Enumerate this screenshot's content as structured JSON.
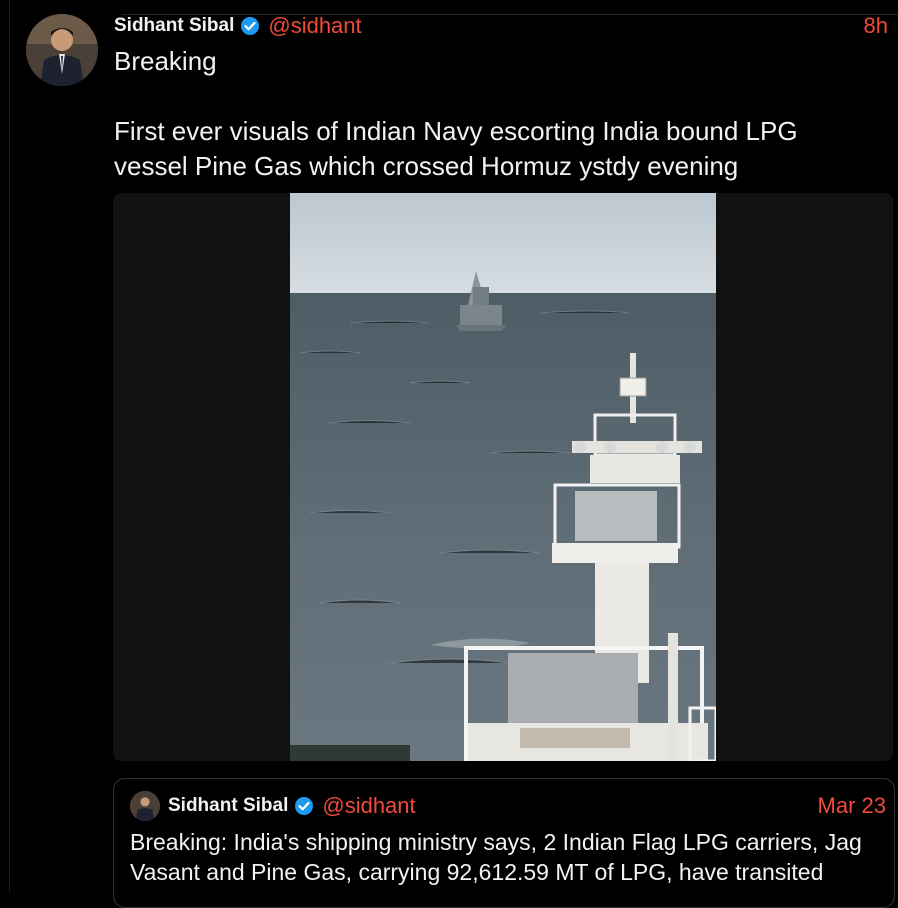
{
  "tweet": {
    "author_name": "Sidhant Sibal",
    "handle": "@sidhant",
    "time": "8h",
    "text": "Breaking\n\nFirst ever visuals of Indian Navy escorting India bound LPG vessel Pine Gas which crossed Hormuz ystdy evening",
    "verified_icon": "verified-badge-icon",
    "media": {
      "type": "photo"
    }
  },
  "quoted": {
    "author_name": "Sidhant Sibal",
    "handle": "@sidhant",
    "time": "Mar 23",
    "text": "Breaking: India's shipping ministry says, 2 Indian Flag LPG carriers, Jag Vasant and Pine Gas, carrying 92,612.59 MT of LPG, have transited"
  },
  "colors": {
    "accent": "#f04a3a",
    "verified": "#1d9bf0",
    "background": "#000000"
  }
}
